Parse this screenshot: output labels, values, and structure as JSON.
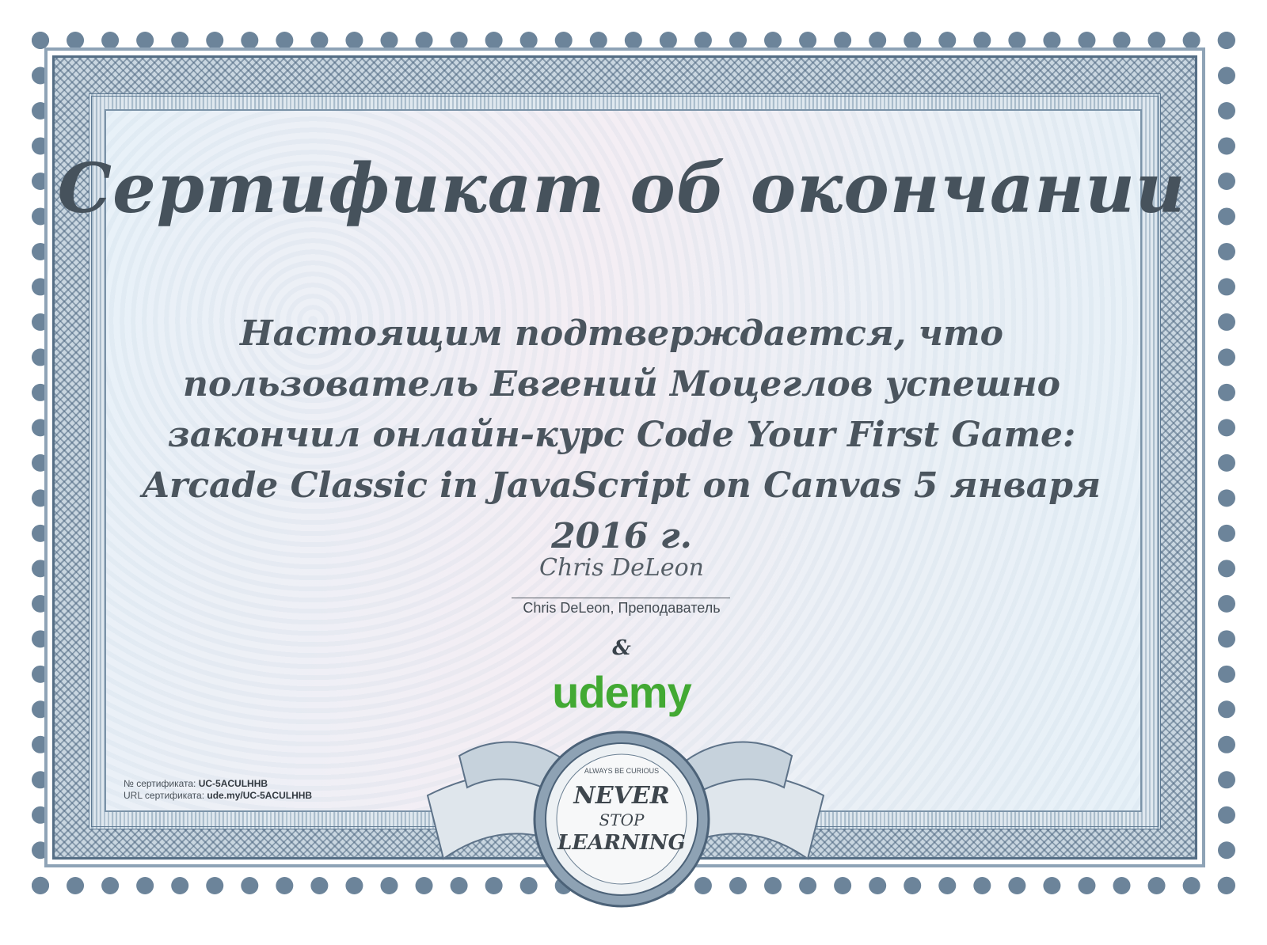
{
  "certificate": {
    "title": "Сертификат об окончании",
    "statement": "Настоящим подтверждается, что пользователь Евгений Моцеглов успешно закончил онлайн-курс Code Your First Game: Arcade Classic in JavaScript on Canvas 5 января 2016 г.",
    "signature_script": "Chris DeLeon",
    "signature_caption": "Chris DeLeon, Преподаватель",
    "ampersand": "&",
    "brand": "udemy",
    "cert_number_label": "№ сертификата:",
    "cert_number": "UC-5ACULHHB",
    "cert_url_label": "URL сертификата:",
    "cert_url": "ude.my/UC-5ACULHHB"
  },
  "badge": {
    "top_text": "ALWAYS BE CURIOUS",
    "line1": "NEVER",
    "line2": "STOP",
    "line3": "LEARNING"
  },
  "colors": {
    "frame": "#556e85",
    "title": "#46525c",
    "brand": "#42a933"
  }
}
